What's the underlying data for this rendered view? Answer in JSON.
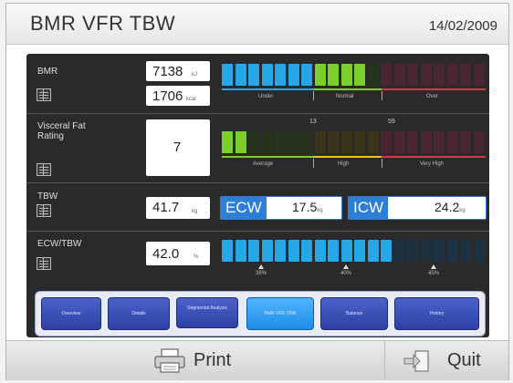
{
  "header": {
    "title": "BMR VFR TBW",
    "date": "14/02/2009"
  },
  "bmr": {
    "label": "BMR",
    "value_kj": "7138",
    "unit_kj": "kJ",
    "value_kcal": "1706",
    "unit_kcal": "kcal",
    "scale": [
      "Under",
      "Normal",
      "Over"
    ],
    "level_segments": 11
  },
  "visceral": {
    "label": "Visceral Fat\nRating",
    "value": "7",
    "marks": [
      "13",
      "59"
    ],
    "scale": [
      "Average",
      "High",
      "Very High"
    ],
    "level_segments": 2
  },
  "tbw": {
    "label": "TBW",
    "value": "41.7",
    "unit": "kg",
    "ecw_label": "ECW",
    "ecw_value": "17.5",
    "ecw_unit": "kg",
    "icw_label": "ICW",
    "icw_value": "24.2",
    "icw_unit": "kg"
  },
  "ecw_tbw": {
    "label": "ECW/TBW",
    "value": "42.0",
    "unit": "%",
    "marks": [
      "36%",
      "40%",
      "45%"
    ],
    "level_segments": 13
  },
  "tabs": [
    {
      "label": "Overview"
    },
    {
      "label": "Details"
    },
    {
      "label": "Segmental Analysis"
    },
    {
      "label": "BMR VFR TBW"
    },
    {
      "label": "Balance"
    },
    {
      "label": "History"
    }
  ],
  "footer": {
    "print_label": "Print",
    "quit_label": "Quit"
  },
  "colors": {
    "blue": "#26a8e8",
    "green": "#7ccf2a",
    "dark_green": "#24331c",
    "dark_red": "#4a2730",
    "dark_blue": "#1d3140",
    "red": "#d8354a",
    "yellow": "#f0c419",
    "accent_tab": "#2c7ed6"
  }
}
